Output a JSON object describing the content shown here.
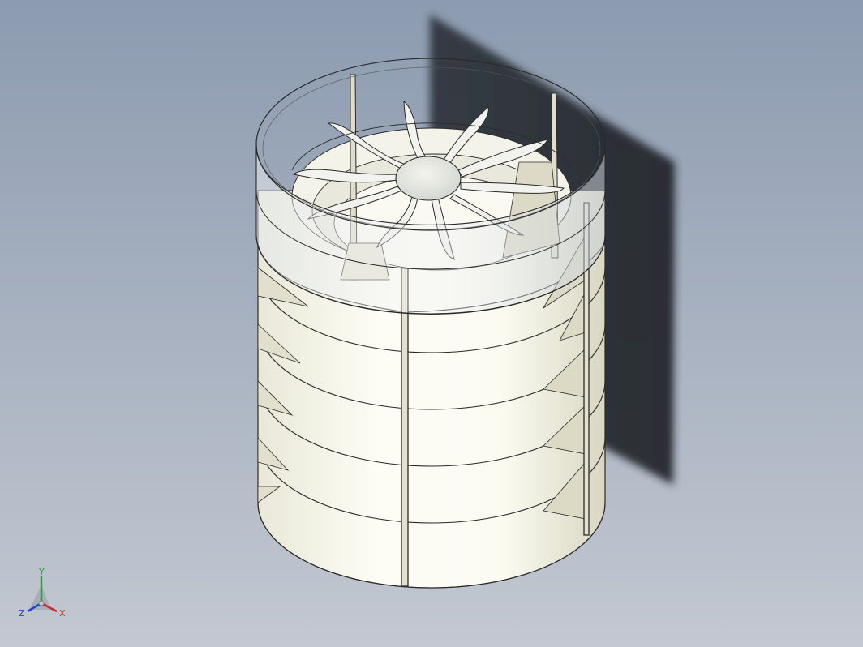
{
  "viewport": {
    "background_top": "#8c9bb0",
    "background_bottom": "#c3c8d1"
  },
  "model": {
    "body_color": "#f6f6ee",
    "shade_color": "#dedcc8",
    "glass_color": "#d6dee6",
    "edge_color": "#2a2a2a",
    "shadow_color": "#2a2f35"
  },
  "triad": {
    "x_label": "X",
    "y_label": "Y",
    "z_label": "Z",
    "x_color": "#d0282c",
    "y_color": "#2ea13a",
    "z_color": "#2244cc"
  }
}
